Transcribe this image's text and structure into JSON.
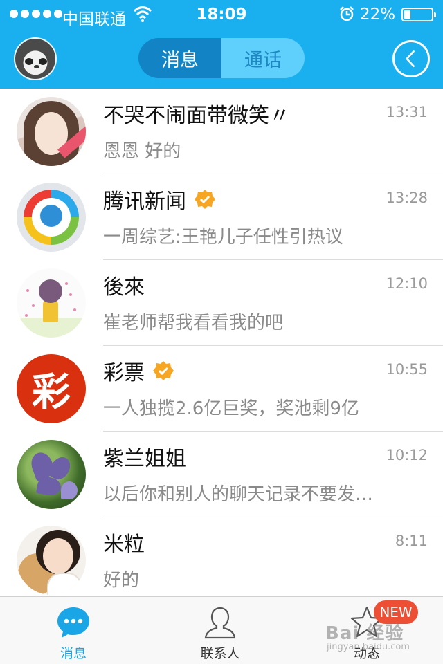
{
  "status_bar": {
    "carrier": "中国联通",
    "time": "18:09",
    "battery_percent": "22%",
    "battery_level": 0.22,
    "signal_icon": "signal-dots-icon",
    "wifi_icon": "wifi-icon",
    "alarm_icon": "alarm-clock-icon"
  },
  "header": {
    "tabs": [
      {
        "label": "消息",
        "active": true
      },
      {
        "label": "通话",
        "active": false
      }
    ],
    "back_icon": "back-circle-icon",
    "accent_color": "#1ab0ef"
  },
  "conversations": [
    {
      "name": "不哭不闹面带微笑〃",
      "time": "13:31",
      "preview": "恩恩  好的",
      "verified": false
    },
    {
      "name": "腾讯新闻",
      "time": "13:28",
      "preview": "一周综艺:王艳儿子任性引热议",
      "verified": true
    },
    {
      "name": "後來",
      "time": "12:10",
      "preview": "崔老师帮我看看我的吧",
      "verified": false
    },
    {
      "name": "彩票",
      "time": "10:55",
      "preview": "一人独揽2.6亿巨奖，奖池剩9亿",
      "verified": true,
      "avatar_text": "彩"
    },
    {
      "name": "紫兰姐姐",
      "time": "10:12",
      "preview": "以后你和别人的聊天记录不要发…",
      "verified": false
    },
    {
      "name": "米粒",
      "time": "8:11",
      "preview": "好的",
      "verified": false
    }
  ],
  "tabbar": {
    "items": [
      {
        "label": "消息",
        "icon": "chat-bubble-icon",
        "active": true
      },
      {
        "label": "联系人",
        "icon": "contacts-person-icon",
        "active": false
      },
      {
        "label": "动态",
        "icon": "star-icon",
        "active": false
      }
    ],
    "badge": "NEW"
  },
  "watermark": {
    "text": "Bai 经验",
    "sub": "jingyan.baidu.com"
  }
}
